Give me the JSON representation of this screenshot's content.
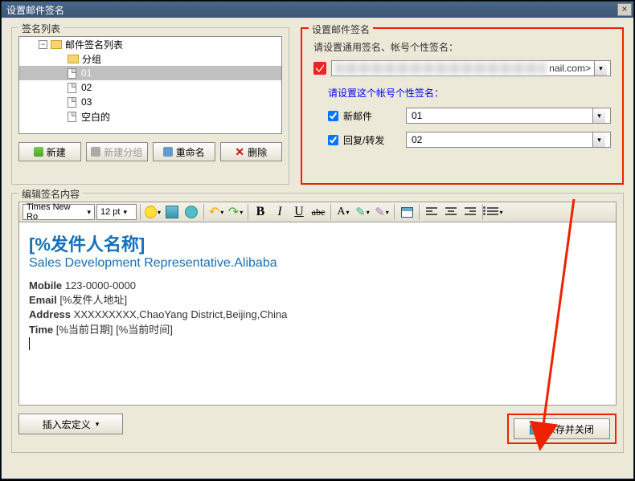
{
  "window": {
    "title": "设置邮件签名"
  },
  "panels": {
    "list_title": "签名列表",
    "config_title": "设置邮件签名",
    "editor_title": "编辑签名内容"
  },
  "tree": {
    "root": "邮件签名列表",
    "group": "分组",
    "items": [
      "01",
      "02",
      "03",
      "空白的"
    ],
    "selected_index": 0
  },
  "tree_btns": {
    "new": "新建",
    "newgroup": "新建分组",
    "rename": "重命名",
    "delete": "删除"
  },
  "config": {
    "prompt": "请设置通用签名、帐号个性签名：",
    "account_tail": "nail.com>",
    "sub_prompt": "请设置这个帐号个性签名：",
    "row1_label": "新邮件",
    "row1_value": "01",
    "row1_checked": true,
    "row2_label": "回复/转发",
    "row2_value": "02",
    "row2_checked": true
  },
  "toolbar": {
    "font": "Times New Ro",
    "size": "12 pt",
    "bold": "B",
    "italic": "I",
    "underline": "U",
    "A": "A",
    "strike": "abc"
  },
  "signature": {
    "name": "[%发件人名称]",
    "role": "Sales Development Representative.Alibaba",
    "mobile_lbl": "Mobile",
    "mobile": "123-0000-0000",
    "email_lbl": "Email",
    "email": "[%发件人地址]",
    "addr_lbl": "Address",
    "addr": "XXXXXXXXX,ChaoYang District,Beijing,China",
    "time_lbl": "Time",
    "time": "[%当前日期] [%当前时间]"
  },
  "bottom": {
    "insert_macro": "插入宏定义",
    "save_close": "保存并关闭"
  }
}
